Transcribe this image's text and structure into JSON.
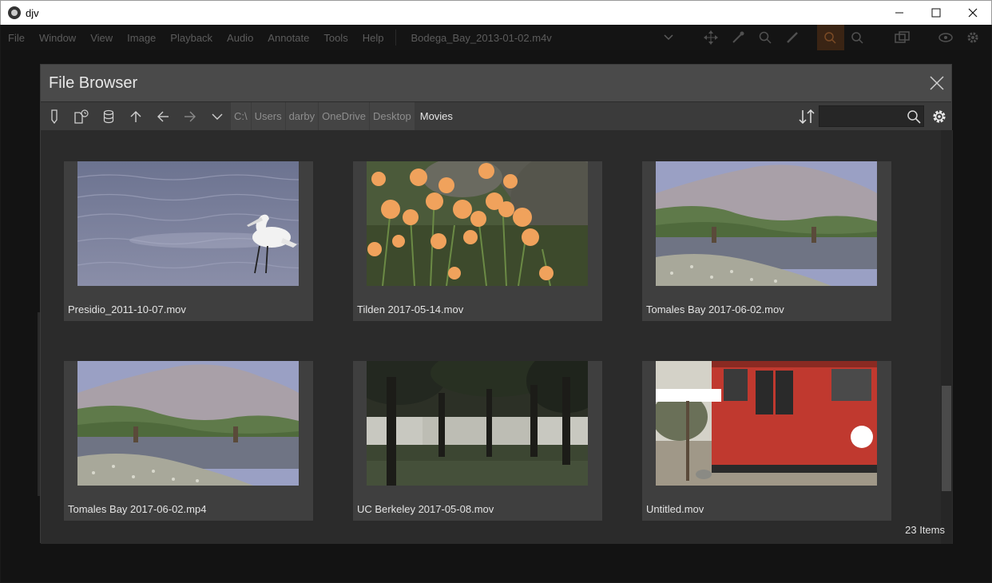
{
  "window": {
    "title": "djv",
    "minimize": "—",
    "maximize": "☐",
    "close": "✕"
  },
  "menu": {
    "items": [
      "File",
      "Window",
      "View",
      "Image",
      "Playback",
      "Audio",
      "Annotate",
      "Tools",
      "Help"
    ],
    "current_file": "Bodega_Bay_2013-01-02.m4v"
  },
  "dialog": {
    "title": "File Browser",
    "breadcrumbs": [
      "C:\\",
      "Users",
      "darby",
      "OneDrive",
      "Desktop"
    ],
    "current_folder": "Movies",
    "search_placeholder": "",
    "item_count": "23 Items"
  },
  "files": [
    {
      "name": "Presidio_2011-10-07.mov",
      "thumb": "egret"
    },
    {
      "name": "Tilden 2017-05-14.mov",
      "thumb": "poppies"
    },
    {
      "name": "Tomales Bay 2017-06-02.mov",
      "thumb": "bay"
    },
    {
      "name": "Tomales Bay 2017-06-02.mp4",
      "thumb": "bay"
    },
    {
      "name": "UC Berkeley 2017-05-08.mov",
      "thumb": "trees"
    },
    {
      "name": "Untitled.mov",
      "thumb": "train"
    }
  ],
  "colors": {
    "active_tool": "#3a2414",
    "dialog_header": "#4a4a4a",
    "tile_bg": "#3f3f3f"
  }
}
